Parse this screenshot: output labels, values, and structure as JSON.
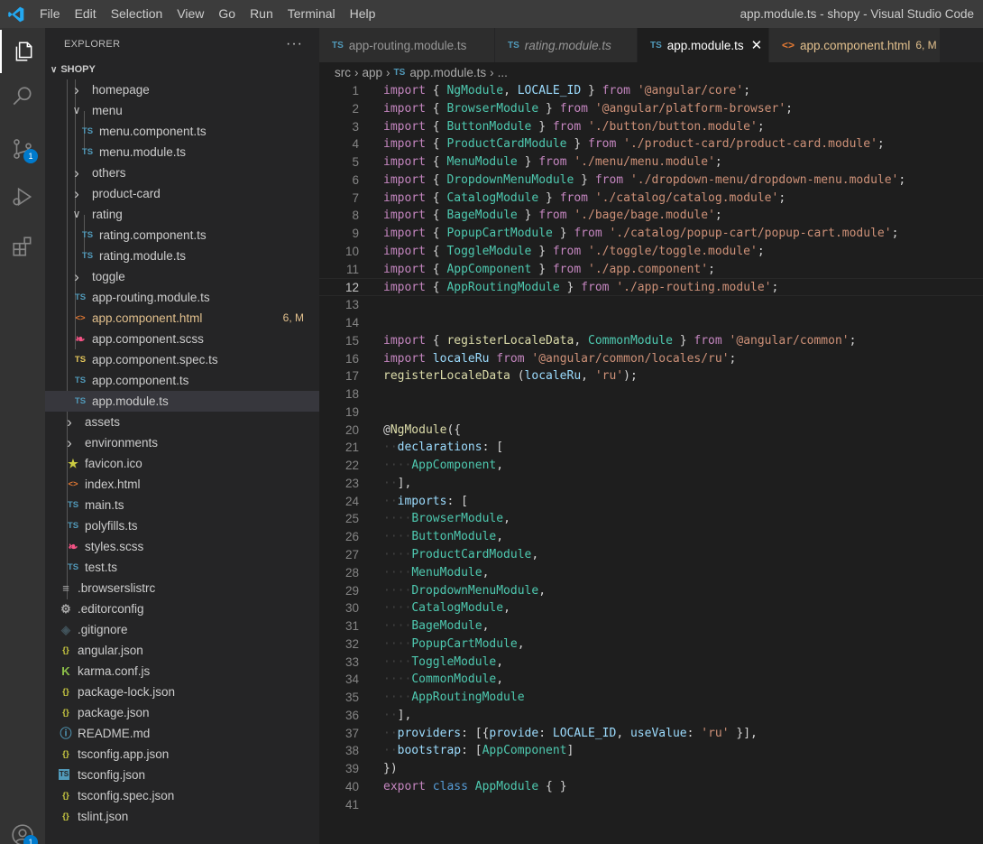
{
  "window": {
    "menu": [
      "File",
      "Edit",
      "Selection",
      "View",
      "Go",
      "Run",
      "Terminal",
      "Help"
    ],
    "title": "app.module.ts - shopy - Visual Studio Code"
  },
  "activity_bar": {
    "items": [
      "explorer-icon",
      "search-icon",
      "source-control-icon",
      "run-debug-icon",
      "extensions-icon",
      "account-icon"
    ],
    "source_control_badge": "1",
    "account_badge": "1"
  },
  "sidebar": {
    "header": "EXPLORER",
    "more": "···",
    "section": "SHOPY",
    "items": [
      {
        "label": "homepage",
        "type": "folder",
        "open": false
      },
      {
        "label": "menu",
        "type": "folder",
        "open": true
      },
      {
        "label": "menu.component.ts",
        "type": "ts"
      },
      {
        "label": "menu.module.ts",
        "type": "ts"
      },
      {
        "label": "others",
        "type": "folder",
        "open": false
      },
      {
        "label": "product-card",
        "type": "folder",
        "open": false
      },
      {
        "label": "rating",
        "type": "folder",
        "open": true
      },
      {
        "label": "rating.component.ts",
        "type": "ts"
      },
      {
        "label": "rating.module.ts",
        "type": "ts"
      },
      {
        "label": "toggle",
        "type": "folder",
        "open": false
      },
      {
        "label": "app-routing.module.ts",
        "type": "ts"
      },
      {
        "label": "app.component.html",
        "type": "html",
        "badge": "6, M"
      },
      {
        "label": "app.component.scss",
        "type": "scss"
      },
      {
        "label": "app.component.spec.ts",
        "type": "spec"
      },
      {
        "label": "app.component.ts",
        "type": "ts"
      },
      {
        "label": "app.module.ts",
        "type": "ts",
        "selected": true
      },
      {
        "label": "assets",
        "type": "folder",
        "open": false
      },
      {
        "label": "environments",
        "type": "folder",
        "open": false
      },
      {
        "label": "favicon.ico",
        "type": "star"
      },
      {
        "label": "index.html",
        "type": "html"
      },
      {
        "label": "main.ts",
        "type": "ts"
      },
      {
        "label": "polyfills.ts",
        "type": "ts"
      },
      {
        "label": "styles.scss",
        "type": "scss"
      },
      {
        "label": "test.ts",
        "type": "ts"
      },
      {
        "label": ".browserslistrc",
        "type": "lines"
      },
      {
        "label": ".editorconfig",
        "type": "gear"
      },
      {
        "label": ".gitignore",
        "type": "git"
      },
      {
        "label": "angular.json",
        "type": "json"
      },
      {
        "label": "karma.conf.js",
        "type": "karma"
      },
      {
        "label": "package-lock.json",
        "type": "json"
      },
      {
        "label": "package.json",
        "type": "json"
      },
      {
        "label": "README.md",
        "type": "info"
      },
      {
        "label": "tsconfig.app.json",
        "type": "json"
      },
      {
        "label": "tsconfig.json",
        "type": "tsconfig"
      },
      {
        "label": "tsconfig.spec.json",
        "type": "json"
      },
      {
        "label": "tslint.json",
        "type": "json"
      }
    ]
  },
  "tabs": [
    {
      "label": "app-routing.module.ts",
      "icon": "TS"
    },
    {
      "label": "rating.module.ts",
      "icon": "TS"
    },
    {
      "label": "app.module.ts",
      "icon": "TS",
      "close": "✕"
    },
    {
      "label": "app.component.html",
      "icon": "<>",
      "badge": "6, M"
    }
  ],
  "breadcrumb": {
    "parts": [
      "src",
      "app",
      "app.module.ts",
      "..."
    ],
    "icon": "TS"
  },
  "editor": {
    "current_line": 12,
    "lines": [
      "import { NgModule, LOCALE_ID } from '@angular/core';",
      "import { BrowserModule } from '@angular/platform-browser';",
      "import { ButtonModule } from './button/button.module';",
      "import { ProductCardModule } from './product-card/product-card.module';",
      "import { MenuModule } from './menu/menu.module';",
      "import { DropdownMenuModule } from './dropdown-menu/dropdown-menu.module';",
      "import { CatalogModule } from './catalog/catalog.module';",
      "import { BageModule } from './bage/bage.module';",
      "import { PopupCartModule } from './catalog/popup-cart/popup-cart.module';",
      "import { ToggleModule } from './toggle/toggle.module';",
      "import { AppComponent } from './app.component';",
      "import { AppRoutingModule } from './app-routing.module';",
      "",
      "",
      "import { registerLocaleData, CommonModule } from '@angular/common';",
      "import localeRu from '@angular/common/locales/ru';",
      "registerLocaleData (localeRu, 'ru');",
      "",
      "",
      "@NgModule({",
      "  declarations: [",
      "    AppComponent,",
      "  ],",
      "  imports: [",
      "    BrowserModule,",
      "    ButtonModule,",
      "    ProductCardModule,",
      "    MenuModule,",
      "    DropdownMenuModule,",
      "    CatalogModule,",
      "    BageModule,",
      "    PopupCartModule,",
      "    ToggleModule,",
      "    CommonModule,",
      "    AppRoutingModule",
      "  ],",
      "  providers: [{provide: LOCALE_ID, useValue: 'ru' }],",
      "  bootstrap: [AppComponent]",
      "})",
      "export class AppModule { }",
      ""
    ]
  }
}
